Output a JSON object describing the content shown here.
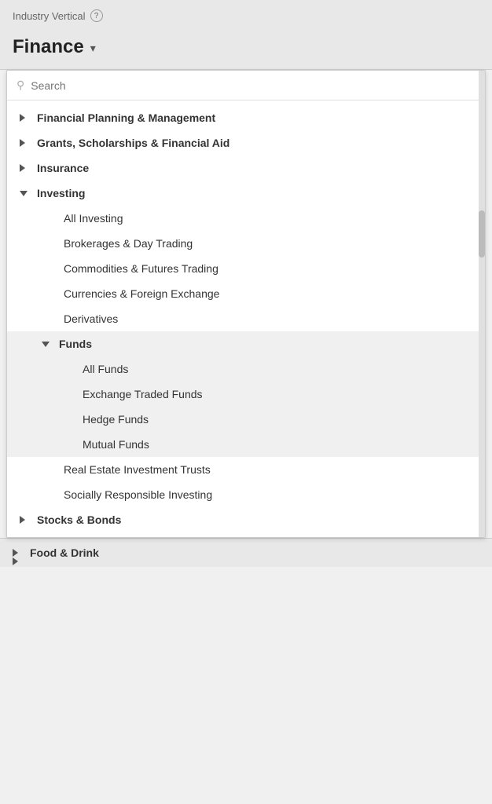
{
  "header": {
    "industry_label": "Industry Vertical",
    "help_icon": "?",
    "selected_value": "Finance",
    "dropdown_arrow": "▾"
  },
  "search": {
    "placeholder": "Search"
  },
  "tree": {
    "items": [
      {
        "id": "financial-planning",
        "label": "Financial Planning & Management",
        "type": "parent",
        "expanded": false
      },
      {
        "id": "grants",
        "label": "Grants, Scholarships & Financial Aid",
        "type": "parent",
        "expanded": false
      },
      {
        "id": "insurance",
        "label": "Insurance",
        "type": "parent",
        "expanded": false
      },
      {
        "id": "investing",
        "label": "Investing",
        "type": "parent",
        "expanded": true
      },
      {
        "id": "all-investing",
        "label": "All Investing",
        "type": "child"
      },
      {
        "id": "brokerages",
        "label": "Brokerages & Day Trading",
        "type": "child"
      },
      {
        "id": "commodities",
        "label": "Commodities & Futures Trading",
        "type": "child"
      },
      {
        "id": "currencies",
        "label": "Currencies & Foreign Exchange",
        "type": "child"
      },
      {
        "id": "derivatives",
        "label": "Derivatives",
        "type": "child"
      },
      {
        "id": "funds",
        "label": "Funds",
        "type": "parent-sub",
        "expanded": true
      },
      {
        "id": "all-funds",
        "label": "All Funds",
        "type": "sub-child"
      },
      {
        "id": "etf",
        "label": "Exchange Traded Funds",
        "type": "sub-child"
      },
      {
        "id": "hedge-funds",
        "label": "Hedge Funds",
        "type": "sub-child"
      },
      {
        "id": "mutual-funds",
        "label": "Mutual Funds",
        "type": "sub-child"
      },
      {
        "id": "real-estate",
        "label": "Real Estate Investment Trusts",
        "type": "child"
      },
      {
        "id": "socially-responsible",
        "label": "Socially Responsible Investing",
        "type": "child"
      },
      {
        "id": "stocks-bonds",
        "label": "Stocks & Bonds",
        "type": "parent",
        "expanded": false
      }
    ]
  },
  "bottom": {
    "label": "Food & Drink"
  }
}
